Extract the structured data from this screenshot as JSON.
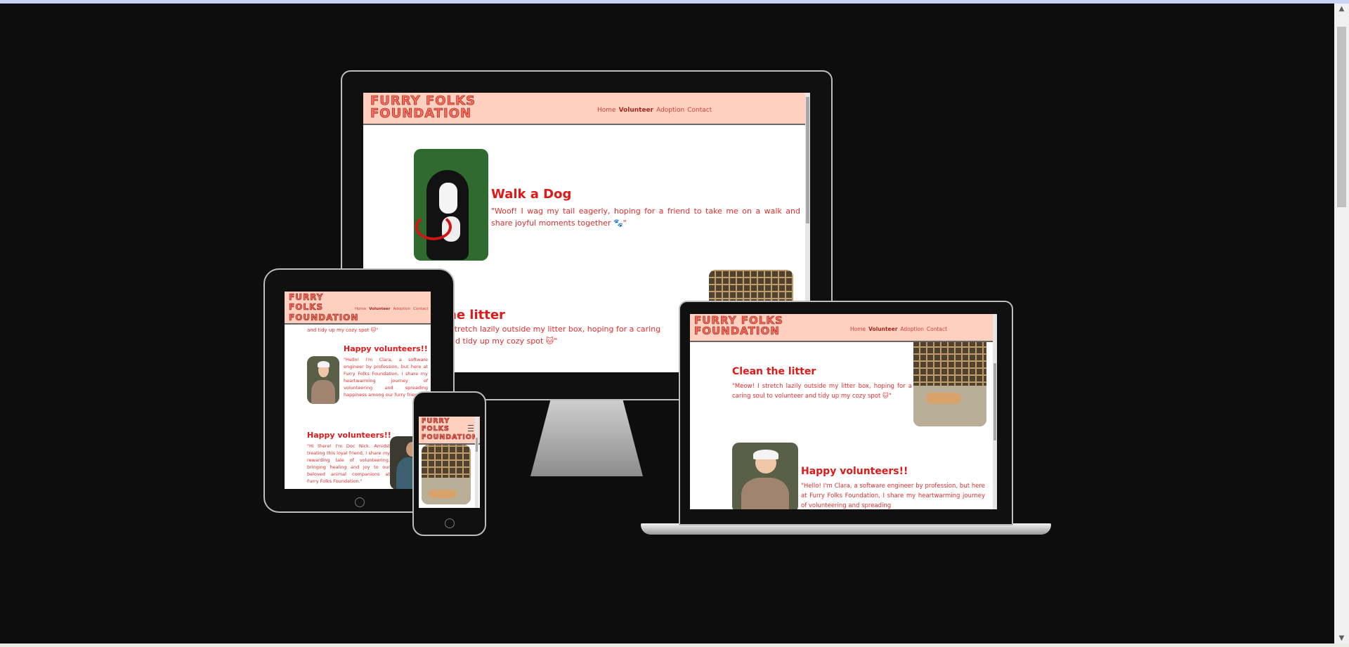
{
  "site": {
    "brand_line1": "FURRY FOLKS",
    "brand_line2": "FOUNDATION",
    "brand_word1": "FURRY",
    "brand_word2": "FOLKS",
    "brand_word3": "FOUNDATION",
    "nav": [
      "Home",
      "Volunteer",
      "Adoption",
      "Contact"
    ],
    "active_nav": "Volunteer",
    "menu_icon": "hamburger-icon",
    "colors": {
      "navbar_bg": "#ffcfbf",
      "brand": "#ff6a5a",
      "heading": "#e01818",
      "text": "#e12d2d",
      "page_bg": "#0e0d0e"
    }
  },
  "desktop": {
    "card1_heading": "Walk a Dog",
    "card1_text": "\"Woof! I wag my tail eagerly, hoping for a friend to take me on a walk and share joyful moments together 🐾\"",
    "card2_heading_fragment": "he litter",
    "card2_line1": "stretch lazily outside my litter box, hoping for a caring",
    "card2_line2": "nd tidy up my cozy spot 🐱\""
  },
  "tablet": {
    "fragment": "and tidy up my cozy spot 🐱\"",
    "card1_heading": "Happy volunteers!!",
    "card1_text": "\"Hello! I'm Clara, a software engineer by profession, but here at Furry Folks Foundation, I share my heartwarming journey of volunteering and spreading happiness among our furry friends.\"",
    "card2_heading": "Happy volunteers!!",
    "card2_text": "\"Hi there! I'm Doc Nick. Amidst treating this loyal friend, I share my rewarding tale of volunteering, bringing healing and joy to our beloved animal companions at Furry Folks Foundation.\""
  },
  "laptop": {
    "card1_heading": "Clean the litter",
    "card1_text": "\"Meow! I stretch lazily outside my litter box, hoping for a caring soul to volunteer and tidy up my cozy spot 🐱\"",
    "card2_heading": "Happy volunteers!!",
    "card2_text": "\"Hello! I'm Clara, a software engineer by profession, but here at Furry Folks Foundation, I share my heartwarming journey of volunteering and spreading"
  }
}
